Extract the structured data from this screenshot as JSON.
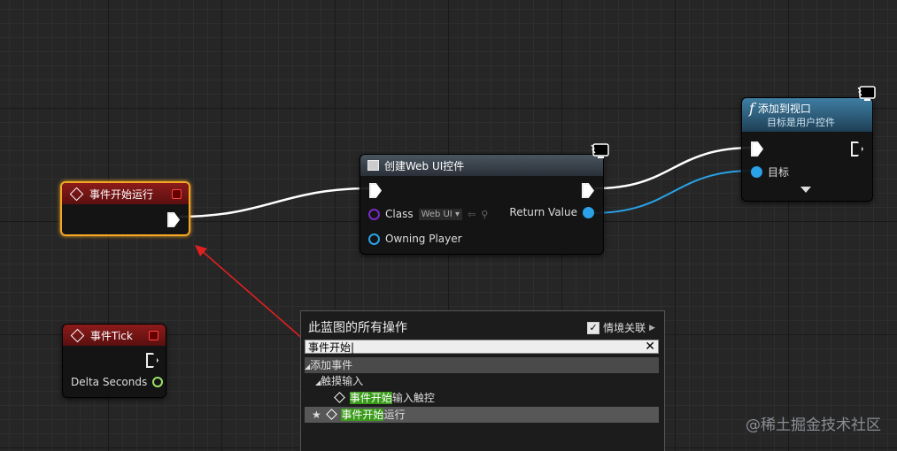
{
  "nodes": {
    "begin_play": {
      "title": "事件开始运行"
    },
    "tick": {
      "title": "事件Tick",
      "pin_delta": "Delta Seconds"
    },
    "create_widget": {
      "title": "创建Web UI控件",
      "pin_class": "Class",
      "class_value": "Web UI",
      "pin_owning": "Owning Player",
      "pin_return": "Return Value"
    },
    "add_viewport": {
      "title": "添加到视口",
      "subtitle": "目标是用户控件",
      "func_glyph": "f",
      "pin_target": "目标"
    }
  },
  "menu": {
    "title": "此蓝图的所有操作",
    "context_label": "情境关联",
    "search_value": "事件开始",
    "tree": {
      "category": "添加事件",
      "subcategory": "触摸输入",
      "item1_match": "事件开始",
      "item1_rest": "输入触控",
      "item2_match": "事件开始",
      "item2_rest": "运行"
    }
  },
  "watermark": "@稀土掘金技术社区",
  "colors": {
    "exec_wire": "#ffffff",
    "object_wire": "#2aa1e8",
    "event_header": "#8c1b1b",
    "function_header": "#3f7ea3",
    "selection": "#f5a623",
    "arrow": "#e02020",
    "search_highlight": "#3a9b1a"
  }
}
